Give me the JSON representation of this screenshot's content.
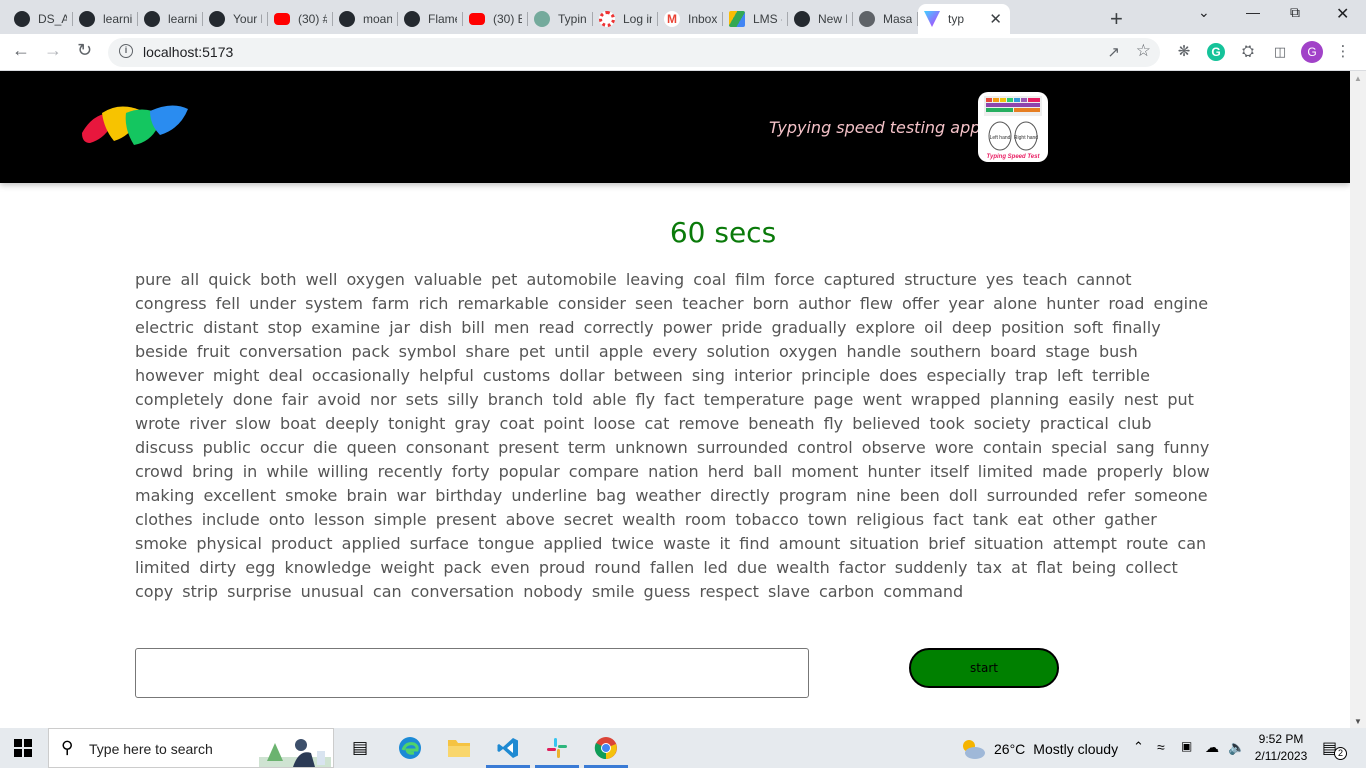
{
  "browser": {
    "tabs": [
      {
        "title": "DS_Al",
        "icon": "github-icon",
        "kind": "gh"
      },
      {
        "title": "learnir",
        "icon": "github-icon",
        "kind": "gh"
      },
      {
        "title": "learnir",
        "icon": "github-icon",
        "kind": "gh"
      },
      {
        "title": "Your F",
        "icon": "github-icon",
        "kind": "gh"
      },
      {
        "title": "(30) #",
        "icon": "youtube-icon",
        "kind": "yt"
      },
      {
        "title": "moan",
        "icon": "github-icon",
        "kind": "gh"
      },
      {
        "title": "Flame",
        "icon": "github-icon",
        "kind": "gh"
      },
      {
        "title": "(30) B",
        "icon": "youtube-icon",
        "kind": "yt"
      },
      {
        "title": "Typing",
        "icon": "chatgpt-icon",
        "kind": "gpt"
      },
      {
        "title": "Log in",
        "icon": "login-icon",
        "kind": "lg"
      },
      {
        "title": "Inbox",
        "icon": "gmail-icon",
        "kind": "gm"
      },
      {
        "title": "LMS -",
        "icon": "drive-icon",
        "kind": "lms"
      },
      {
        "title": "New F",
        "icon": "github-icon",
        "kind": "gh"
      },
      {
        "title": "Masai",
        "icon": "globe-icon",
        "kind": "gl"
      },
      {
        "title": "typ",
        "icon": "vite-icon",
        "kind": "vt",
        "active": true
      }
    ],
    "url": "localhost:5173",
    "profile_initial": "G",
    "grammarly_initial": "G"
  },
  "site": {
    "tagline": "Typying speed testing app",
    "app_icon_labels": {
      "left": "Left hand",
      "right": "Right hand",
      "caption": "Typing Speed Test"
    }
  },
  "timer": "60 secs",
  "words": "pure all quick both well oxygen valuable pet automobile leaving coal film force captured structure yes teach cannot congress fell under system farm rich remarkable consider seen teacher born author flew offer year alone hunter road engine electric distant stop examine jar dish bill men read correctly power pride gradually explore oil deep position soft finally beside fruit conversation pack symbol share pet until apple every solution oxygen handle southern board stage bush however might deal occasionally helpful customs dollar between sing interior principle does especially trap left terrible completely done fair avoid nor sets silly branch told able fly fact temperature page went wrapped planning easily nest put wrote river slow boat deeply tonight gray coat point loose cat remove beneath fly believed took society practical club discuss public occur die queen consonant present term unknown surrounded control observe wore contain special sang funny crowd bring in while willing recently forty popular compare nation herd ball moment hunter itself limited made properly blow making excellent smoke brain war birthday underline bag weather directly program nine been doll surrounded refer someone clothes include onto lesson simple present above secret wealth room tobacco town religious fact tank eat other gather smoke physical product applied surface tongue applied twice waste it find amount situation brief situation attempt route can limited dirty egg knowledge weight pack even proud round fallen led due wealth factor suddenly tax at flat being collect copy strip surprise unusual can conversation nobody smile guess respect slave carbon command",
  "input": {
    "value": "",
    "placeholder": ""
  },
  "start_label": "start",
  "colors": {
    "timer": "#0a7a0a",
    "start_button": "#008000",
    "header_bg": "#000000",
    "tagline": "#f4c2c8"
  },
  "taskbar": {
    "search_placeholder": "Type here to search",
    "weather": {
      "temp": "26°C",
      "condition": "Mostly cloudy"
    },
    "time": "9:52 PM",
    "date": "2/11/2023",
    "notification_count": "2"
  }
}
